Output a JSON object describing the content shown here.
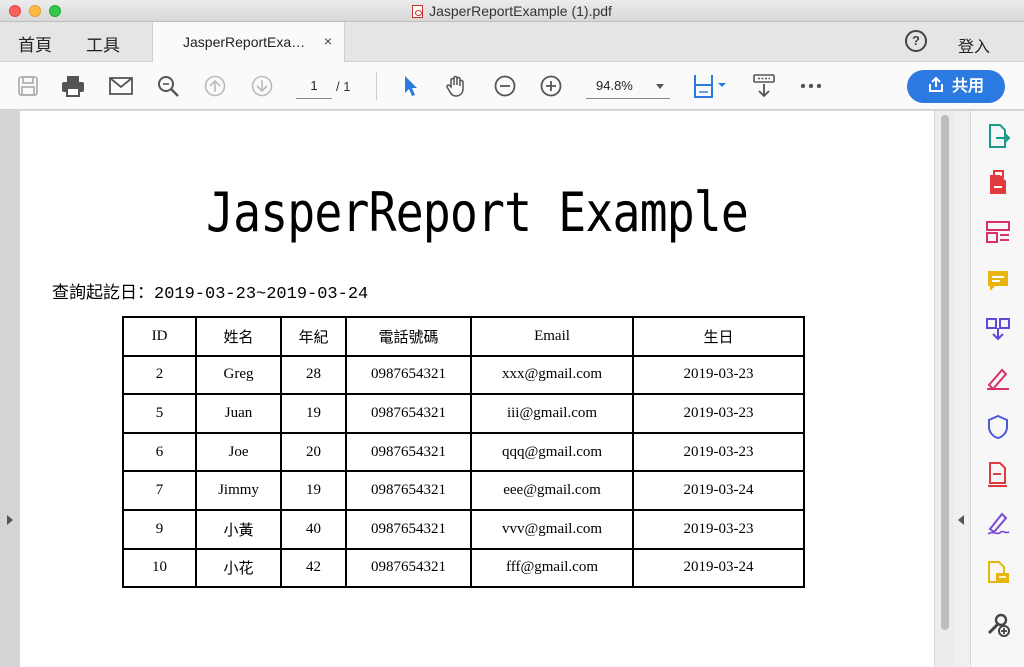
{
  "window": {
    "title": "JasperReportExample (1).pdf"
  },
  "tabs": {
    "home": "首頁",
    "tools": "工具",
    "document": "JasperReportExa…",
    "close": "×",
    "help": "?",
    "login": "登入"
  },
  "toolbar": {
    "page_current": "1",
    "page_total": "/ 1",
    "zoom": "94.8%",
    "share": "共用",
    "icons": [
      "save-icon",
      "print-icon",
      "email-icon",
      "zoom-search-icon",
      "page-up-icon",
      "page-down-icon",
      "select-arrow-icon",
      "hand-icon",
      "zoom-out-icon",
      "zoom-in-icon",
      "fit-page-icon",
      "scroll-mode-icon",
      "more-icon"
    ],
    "accent": "#2a7ae2"
  },
  "document": {
    "title": "JasperReport Example",
    "query_label": "查詢起訖日：2019-03-23~2019-03-24",
    "table": {
      "headers": [
        "ID",
        "姓名",
        "年紀",
        "電話號碼",
        "Email",
        "生日"
      ],
      "rows": [
        [
          "2",
          "Greg",
          "28",
          "0987654321",
          "xxx@gmail.com",
          "2019-03-23"
        ],
        [
          "5",
          "Juan",
          "19",
          "0987654321",
          "iii@gmail.com",
          "2019-03-23"
        ],
        [
          "6",
          "Joe",
          "20",
          "0987654321",
          "qqq@gmail.com",
          "2019-03-23"
        ],
        [
          "7",
          "Jimmy",
          "19",
          "0987654321",
          "eee@gmail.com",
          "2019-03-24"
        ],
        [
          "9",
          "小黃",
          "40",
          "0987654321",
          "vvv@gmail.com",
          "2019-03-23"
        ],
        [
          "10",
          "小花",
          "42",
          "0987654321",
          "fff@gmail.com",
          "2019-03-24"
        ]
      ]
    }
  },
  "right_pane": {
    "tools": [
      {
        "icon": "export-pdf-icon",
        "color": "#1a9a8a"
      },
      {
        "icon": "create-pdf-icon",
        "color": "#e0393e"
      },
      {
        "icon": "organize-pages-icon",
        "color": "#d6336c"
      },
      {
        "icon": "comment-icon",
        "color": "#e8b40f"
      },
      {
        "icon": "combine-files-icon",
        "color": "#5b4bd6"
      },
      {
        "icon": "fill-sign-icon",
        "color": "#d6336c"
      },
      {
        "icon": "protect-icon",
        "color": "#4b5bd6"
      },
      {
        "icon": "edit-pdf-icon",
        "color": "#e0393e"
      },
      {
        "icon": "signature-icon",
        "color": "#7a4bd6"
      },
      {
        "icon": "send-for-review-icon",
        "color": "#e8b40f"
      },
      {
        "icon": "more-tools-icon",
        "color": "#444444"
      }
    ]
  }
}
